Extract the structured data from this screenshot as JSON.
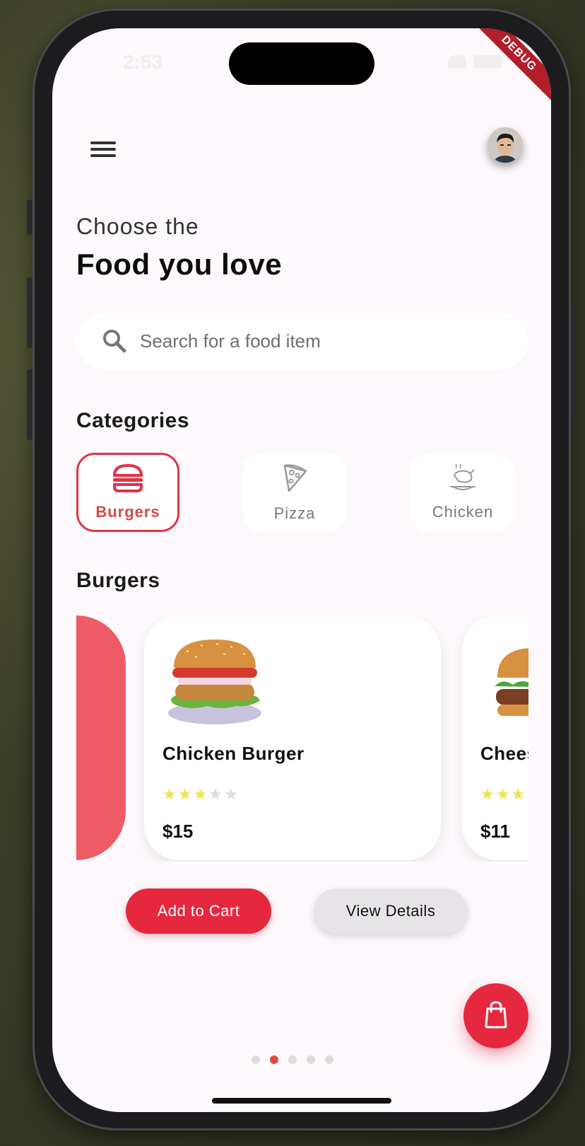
{
  "status": {
    "time": "2:53"
  },
  "header": {
    "subtitle": "Choose the",
    "title": "Food you love"
  },
  "search": {
    "placeholder": "Search for a food item"
  },
  "debug_banner": "DEBUG",
  "categories": {
    "title": "Categories",
    "items": [
      {
        "label": "Burgers",
        "icon": "burger-icon",
        "active": true
      },
      {
        "label": "Pizza",
        "icon": "pizza-icon",
        "active": false
      },
      {
        "label": "Chicken",
        "icon": "chicken-icon",
        "active": false
      }
    ]
  },
  "products": {
    "title": "Burgers",
    "items": [
      {
        "name": "Chicken Burger",
        "rating": 3,
        "max_rating": 5,
        "price": "$15"
      },
      {
        "name": "Chees",
        "rating": 3,
        "max_rating": 5,
        "price": "$11"
      }
    ]
  },
  "actions": {
    "add_to_cart": "Add to Cart",
    "view_details": "View Details"
  },
  "pagination": {
    "count": 5,
    "active_index": 1
  },
  "colors": {
    "accent": "#e6283f",
    "star": "#f5e04a",
    "background": "#fcf8fc"
  }
}
